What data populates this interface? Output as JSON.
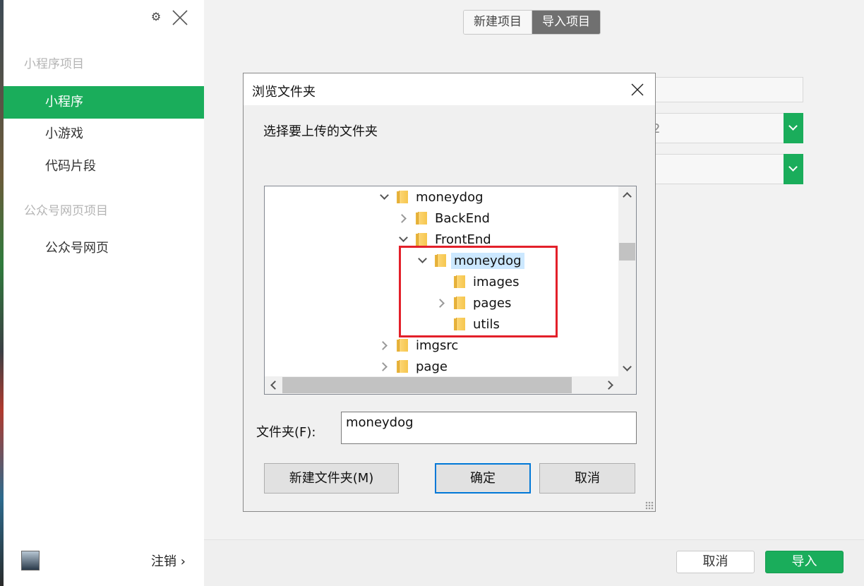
{
  "sidebar": {
    "sections": [
      {
        "title": "小程序项目",
        "items": [
          "小程序",
          "小游戏",
          "代码片段"
        ]
      },
      {
        "title": "公众号网页项目",
        "items": [
          "公众号网页"
        ]
      }
    ],
    "active_item": "小程序",
    "logout_label": "注销 ›"
  },
  "header": {
    "tabs": [
      {
        "label": "新建项目",
        "active": false
      },
      {
        "label": "导入项目",
        "active": true
      }
    ]
  },
  "background_form": {
    "field_fragment": "2"
  },
  "footer": {
    "cancel_label": "取消",
    "import_label": "导入"
  },
  "dialog": {
    "title": "浏览文件夹",
    "prompt": "选择要上传的文件夹",
    "tree": [
      {
        "label": "moneydog",
        "depth": 0,
        "expander": "down",
        "selected": false
      },
      {
        "label": "BackEnd",
        "depth": 1,
        "expander": "right",
        "selected": false
      },
      {
        "label": "FrontEnd",
        "depth": 1,
        "expander": "down",
        "selected": false
      },
      {
        "label": "moneydog",
        "depth": 2,
        "expander": "down",
        "selected": true
      },
      {
        "label": "images",
        "depth": 3,
        "expander": "none",
        "selected": false
      },
      {
        "label": "pages",
        "depth": 3,
        "expander": "right",
        "selected": false
      },
      {
        "label": "utils",
        "depth": 3,
        "expander": "none",
        "selected": false
      },
      {
        "label": "imgsrc",
        "depth": 0,
        "expander": "right",
        "selected": false
      },
      {
        "label": "page",
        "depth": 0,
        "expander": "right",
        "selected": false
      }
    ],
    "folder_field_label": "文件夹(F):",
    "folder_field_value": "moneydog",
    "new_folder_label": "新建文件夹(M)",
    "ok_label": "确定",
    "cancel_label": "取消"
  },
  "colors": {
    "accent_green": "#1aad5b",
    "highlight_red": "#e3202a",
    "selection_blue": "#cce8ff",
    "default_button_border": "#0078d7"
  }
}
